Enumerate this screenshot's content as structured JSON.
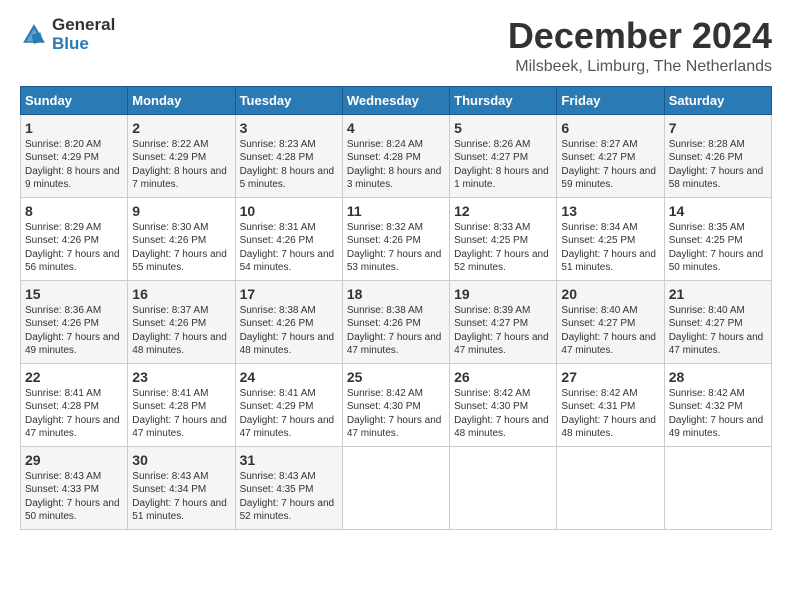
{
  "logo": {
    "general": "General",
    "blue": "Blue"
  },
  "title": "December 2024",
  "location": "Milsbeek, Limburg, The Netherlands",
  "days_of_week": [
    "Sunday",
    "Monday",
    "Tuesday",
    "Wednesday",
    "Thursday",
    "Friday",
    "Saturday"
  ],
  "weeks": [
    [
      {
        "day": "1",
        "sunrise": "Sunrise: 8:20 AM",
        "sunset": "Sunset: 4:29 PM",
        "daylight": "Daylight: 8 hours and 9 minutes."
      },
      {
        "day": "2",
        "sunrise": "Sunrise: 8:22 AM",
        "sunset": "Sunset: 4:29 PM",
        "daylight": "Daylight: 8 hours and 7 minutes."
      },
      {
        "day": "3",
        "sunrise": "Sunrise: 8:23 AM",
        "sunset": "Sunset: 4:28 PM",
        "daylight": "Daylight: 8 hours and 5 minutes."
      },
      {
        "day": "4",
        "sunrise": "Sunrise: 8:24 AM",
        "sunset": "Sunset: 4:28 PM",
        "daylight": "Daylight: 8 hours and 3 minutes."
      },
      {
        "day": "5",
        "sunrise": "Sunrise: 8:26 AM",
        "sunset": "Sunset: 4:27 PM",
        "daylight": "Daylight: 8 hours and 1 minute."
      },
      {
        "day": "6",
        "sunrise": "Sunrise: 8:27 AM",
        "sunset": "Sunset: 4:27 PM",
        "daylight": "Daylight: 7 hours and 59 minutes."
      },
      {
        "day": "7",
        "sunrise": "Sunrise: 8:28 AM",
        "sunset": "Sunset: 4:26 PM",
        "daylight": "Daylight: 7 hours and 58 minutes."
      }
    ],
    [
      {
        "day": "8",
        "sunrise": "Sunrise: 8:29 AM",
        "sunset": "Sunset: 4:26 PM",
        "daylight": "Daylight: 7 hours and 56 minutes."
      },
      {
        "day": "9",
        "sunrise": "Sunrise: 8:30 AM",
        "sunset": "Sunset: 4:26 PM",
        "daylight": "Daylight: 7 hours and 55 minutes."
      },
      {
        "day": "10",
        "sunrise": "Sunrise: 8:31 AM",
        "sunset": "Sunset: 4:26 PM",
        "daylight": "Daylight: 7 hours and 54 minutes."
      },
      {
        "day": "11",
        "sunrise": "Sunrise: 8:32 AM",
        "sunset": "Sunset: 4:26 PM",
        "daylight": "Daylight: 7 hours and 53 minutes."
      },
      {
        "day": "12",
        "sunrise": "Sunrise: 8:33 AM",
        "sunset": "Sunset: 4:25 PM",
        "daylight": "Daylight: 7 hours and 52 minutes."
      },
      {
        "day": "13",
        "sunrise": "Sunrise: 8:34 AM",
        "sunset": "Sunset: 4:25 PM",
        "daylight": "Daylight: 7 hours and 51 minutes."
      },
      {
        "day": "14",
        "sunrise": "Sunrise: 8:35 AM",
        "sunset": "Sunset: 4:25 PM",
        "daylight": "Daylight: 7 hours and 50 minutes."
      }
    ],
    [
      {
        "day": "15",
        "sunrise": "Sunrise: 8:36 AM",
        "sunset": "Sunset: 4:26 PM",
        "daylight": "Daylight: 7 hours and 49 minutes."
      },
      {
        "day": "16",
        "sunrise": "Sunrise: 8:37 AM",
        "sunset": "Sunset: 4:26 PM",
        "daylight": "Daylight: 7 hours and 48 minutes."
      },
      {
        "day": "17",
        "sunrise": "Sunrise: 8:38 AM",
        "sunset": "Sunset: 4:26 PM",
        "daylight": "Daylight: 7 hours and 48 minutes."
      },
      {
        "day": "18",
        "sunrise": "Sunrise: 8:38 AM",
        "sunset": "Sunset: 4:26 PM",
        "daylight": "Daylight: 7 hours and 47 minutes."
      },
      {
        "day": "19",
        "sunrise": "Sunrise: 8:39 AM",
        "sunset": "Sunset: 4:27 PM",
        "daylight": "Daylight: 7 hours and 47 minutes."
      },
      {
        "day": "20",
        "sunrise": "Sunrise: 8:40 AM",
        "sunset": "Sunset: 4:27 PM",
        "daylight": "Daylight: 7 hours and 47 minutes."
      },
      {
        "day": "21",
        "sunrise": "Sunrise: 8:40 AM",
        "sunset": "Sunset: 4:27 PM",
        "daylight": "Daylight: 7 hours and 47 minutes."
      }
    ],
    [
      {
        "day": "22",
        "sunrise": "Sunrise: 8:41 AM",
        "sunset": "Sunset: 4:28 PM",
        "daylight": "Daylight: 7 hours and 47 minutes."
      },
      {
        "day": "23",
        "sunrise": "Sunrise: 8:41 AM",
        "sunset": "Sunset: 4:28 PM",
        "daylight": "Daylight: 7 hours and 47 minutes."
      },
      {
        "day": "24",
        "sunrise": "Sunrise: 8:41 AM",
        "sunset": "Sunset: 4:29 PM",
        "daylight": "Daylight: 7 hours and 47 minutes."
      },
      {
        "day": "25",
        "sunrise": "Sunrise: 8:42 AM",
        "sunset": "Sunset: 4:30 PM",
        "daylight": "Daylight: 7 hours and 47 minutes."
      },
      {
        "day": "26",
        "sunrise": "Sunrise: 8:42 AM",
        "sunset": "Sunset: 4:30 PM",
        "daylight": "Daylight: 7 hours and 48 minutes."
      },
      {
        "day": "27",
        "sunrise": "Sunrise: 8:42 AM",
        "sunset": "Sunset: 4:31 PM",
        "daylight": "Daylight: 7 hours and 48 minutes."
      },
      {
        "day": "28",
        "sunrise": "Sunrise: 8:42 AM",
        "sunset": "Sunset: 4:32 PM",
        "daylight": "Daylight: 7 hours and 49 minutes."
      }
    ],
    [
      {
        "day": "29",
        "sunrise": "Sunrise: 8:43 AM",
        "sunset": "Sunset: 4:33 PM",
        "daylight": "Daylight: 7 hours and 50 minutes."
      },
      {
        "day": "30",
        "sunrise": "Sunrise: 8:43 AM",
        "sunset": "Sunset: 4:34 PM",
        "daylight": "Daylight: 7 hours and 51 minutes."
      },
      {
        "day": "31",
        "sunrise": "Sunrise: 8:43 AM",
        "sunset": "Sunset: 4:35 PM",
        "daylight": "Daylight: 7 hours and 52 minutes."
      },
      null,
      null,
      null,
      null
    ]
  ]
}
